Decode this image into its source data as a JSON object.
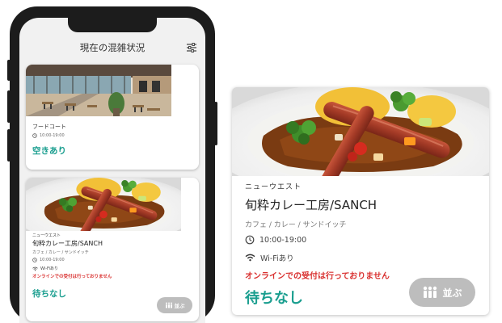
{
  "screen": {
    "title": "現在の混雑状況",
    "filter_icon": "sliders-icon"
  },
  "cards": [
    {
      "name": "フードコート",
      "hours": "10:00-19:00",
      "status": "空きあり",
      "photo": "food-court-interior"
    },
    {
      "area": "ニューウエスト",
      "name": "旬粋カレー工房/SANCH",
      "category": "カフェ / カレー / サンドイッチ",
      "hours": "10:00-19:00",
      "wifi": "Wi-Fiあり",
      "note": "オンラインでの受付は行っておりません",
      "status": "待ちなし",
      "queue_label": "並ぶ",
      "photo": "curry-with-sausage"
    }
  ],
  "colors": {
    "status_green": "#1a9e8f",
    "notice_red": "#d9302f",
    "button_disabled": "#bdbdbd"
  }
}
